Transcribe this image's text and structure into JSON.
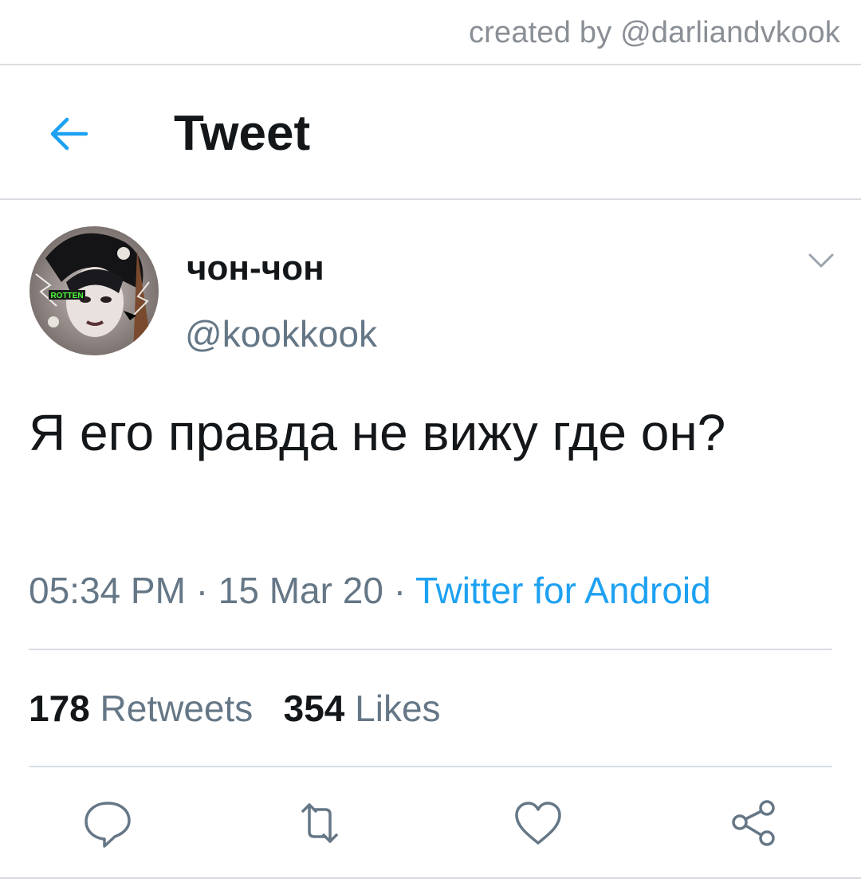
{
  "watermark": {
    "credit": "created by @darliandvkook"
  },
  "app_bar": {
    "back_icon": "arrow-left-icon",
    "title": "Tweet"
  },
  "tweet": {
    "avatar": {
      "badge_text": "ROTTEN"
    },
    "display_name": "чон-чон",
    "handle": "@kookkook",
    "menu_icon": "chevron-down-icon",
    "text": "Я его правда не вижу где он?",
    "time": "05:34 PM",
    "separator": "·",
    "date": "15 Mar 20",
    "source": "Twitter for Android",
    "stats": {
      "retweets_count": "178",
      "retweets_label": "Retweets",
      "likes_count": "354",
      "likes_label": "Likes"
    },
    "actions": [
      "reply-icon",
      "retweet-icon",
      "like-icon",
      "share-icon"
    ]
  },
  "colors": {
    "accent": "#1da1f2",
    "text_primary": "#14171a",
    "text_secondary": "#657786",
    "divider": "#d9dde2"
  }
}
